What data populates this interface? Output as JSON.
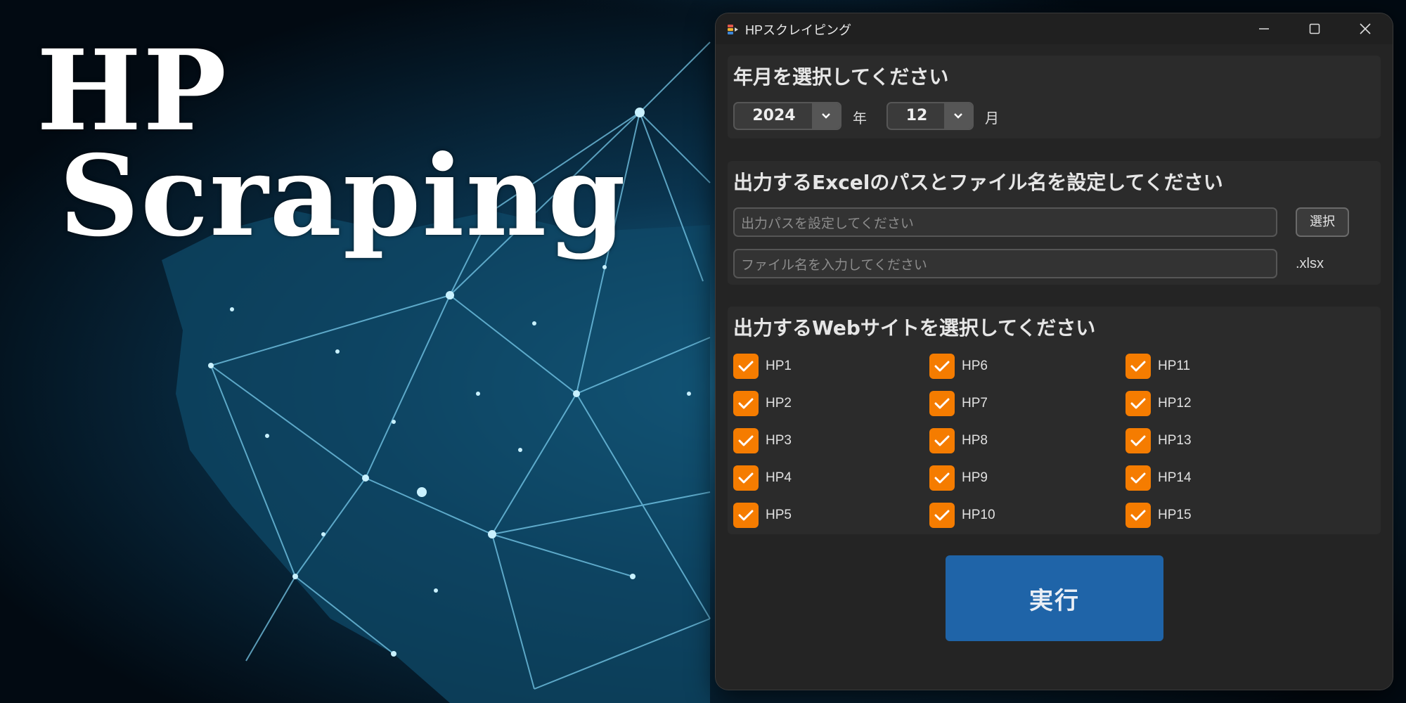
{
  "hero": {
    "line1": "HP",
    "line2": "Scraping"
  },
  "window": {
    "title": "HPスクレイピング"
  },
  "date_section": {
    "title": "年月を選択してください",
    "year": "2024",
    "year_unit": "年",
    "month": "12",
    "month_unit": "月"
  },
  "output_section": {
    "title": "出力するExcelのパスとファイル名を設定してください",
    "path_placeholder": "出力パスを設定してください",
    "path_value": "",
    "select_label": "選択",
    "filename_placeholder": "ファイル名を入力してください",
    "filename_value": "",
    "extension": ".xlsx"
  },
  "sites_section": {
    "title": "出力するWebサイトを選択してください",
    "items": [
      {
        "label": "HP1",
        "checked": true
      },
      {
        "label": "HP2",
        "checked": true
      },
      {
        "label": "HP3",
        "checked": true
      },
      {
        "label": "HP4",
        "checked": true
      },
      {
        "label": "HP5",
        "checked": true
      },
      {
        "label": "HP6",
        "checked": true
      },
      {
        "label": "HP7",
        "checked": true
      },
      {
        "label": "HP8",
        "checked": true
      },
      {
        "label": "HP9",
        "checked": true
      },
      {
        "label": "HP10",
        "checked": true
      },
      {
        "label": "HP11",
        "checked": true
      },
      {
        "label": "HP12",
        "checked": true
      },
      {
        "label": "HP13",
        "checked": true
      },
      {
        "label": "HP14",
        "checked": true
      },
      {
        "label": "HP15",
        "checked": true
      }
    ]
  },
  "run_label": "実行",
  "colors": {
    "accent_orange": "#f57c00",
    "run_button": "#1f64a8",
    "window_bg": "#242424",
    "section_bg": "#2b2b2b"
  },
  "icons": {
    "app": "app-icon",
    "dropdown": "chevron-down-icon",
    "check": "checkmark-icon"
  }
}
